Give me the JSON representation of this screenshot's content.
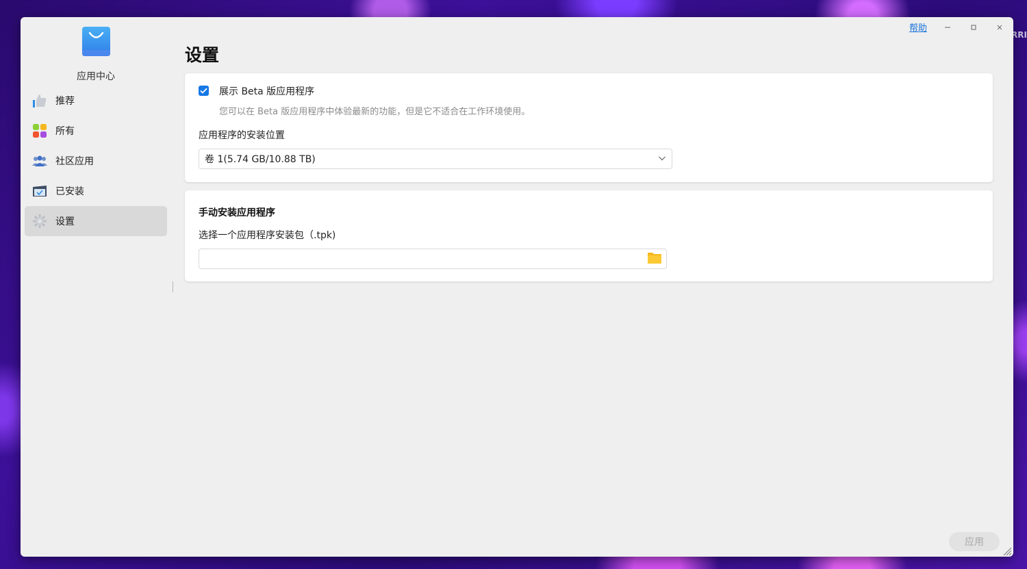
{
  "window": {
    "help_label": "帮助",
    "minimize_icon": "minimize-icon",
    "maximize_icon": "maximize-icon",
    "close_icon": "close-icon"
  },
  "sidebar": {
    "app_title": "应用中心",
    "items": [
      {
        "label": "推荐",
        "icon": "thumbs-up-icon",
        "active": false
      },
      {
        "label": "所有",
        "icon": "grid-icon",
        "active": false
      },
      {
        "label": "社区应用",
        "icon": "people-icon",
        "active": false
      },
      {
        "label": "已安装",
        "icon": "installed-box-icon",
        "active": false
      },
      {
        "label": "设置",
        "icon": "gear-icon",
        "active": true
      }
    ]
  },
  "main": {
    "page_title": "设置",
    "beta": {
      "checked": true,
      "label": "展示 Beta 版应用程序",
      "description": "您可以在 Beta 版应用程序中体验最新的功能，但是它不适合在工作环境使用。"
    },
    "install_location": {
      "label": "应用程序的安装位置",
      "selected": "卷 1(5.74 GB/10.88 TB)"
    },
    "manual_install": {
      "title": "手动安装应用程序",
      "label": "选择一个应用程序安装包（.tpk)",
      "value": ""
    },
    "apply_label": "应用"
  },
  "desktop": {
    "brand_text": "SRRI"
  },
  "colors": {
    "accent": "#1677e6",
    "window_bg": "#efefef",
    "card_bg": "#ffffff",
    "active_nav_bg": "#d9d9d9",
    "folder": "#f6b81e"
  }
}
